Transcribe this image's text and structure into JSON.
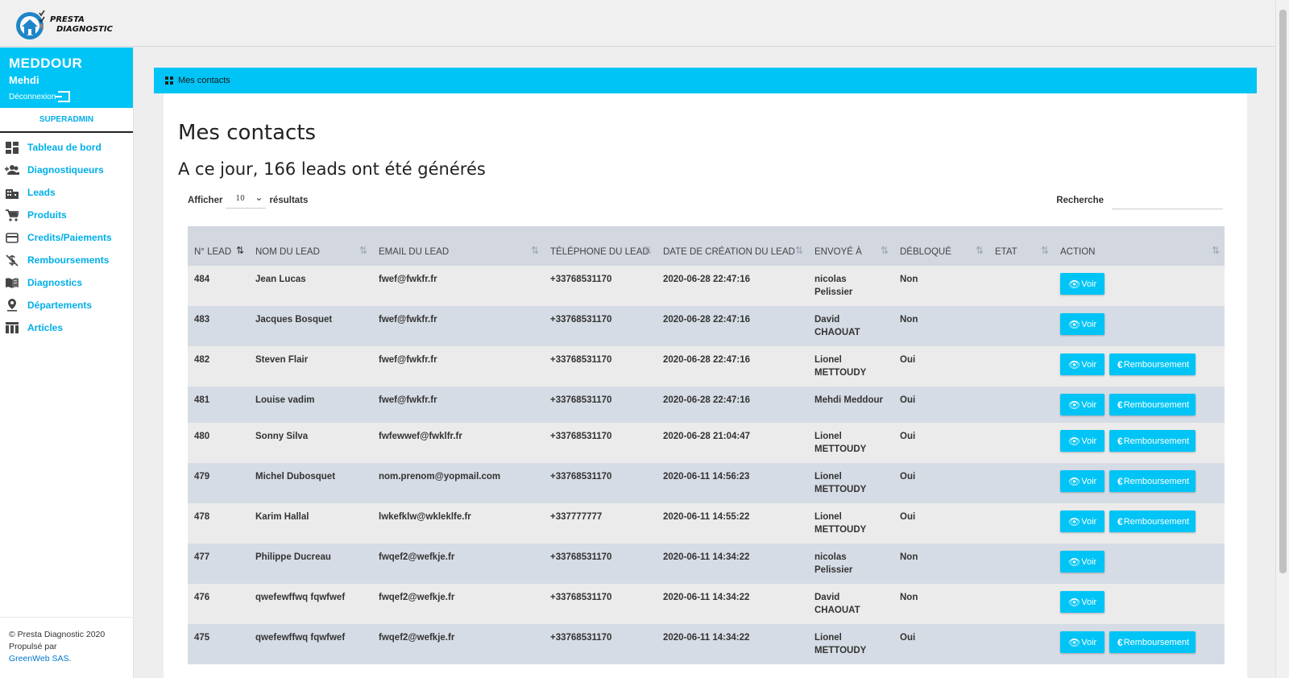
{
  "app": {
    "logo_line1": "PRESTA",
    "logo_line2": "DIAGNOSTIC"
  },
  "user": {
    "last_name": "MEDDOUR",
    "first_name": "Mehdi",
    "logout_label": "Déconnexion",
    "role": "SUPERADMIN"
  },
  "nav": [
    {
      "label": "Tableau de bord",
      "icon": "dashboard-icon"
    },
    {
      "label": "Diagnostiqueurs",
      "icon": "group-add-icon"
    },
    {
      "label": "Leads",
      "icon": "building-icon"
    },
    {
      "label": "Produits",
      "icon": "cart-icon"
    },
    {
      "label": "Credits/Paiements",
      "icon": "credit-card-icon"
    },
    {
      "label": "Remboursements",
      "icon": "money-off-icon"
    },
    {
      "label": "Diagnostics",
      "icon": "book-icon"
    },
    {
      "label": "Départements",
      "icon": "location-pin-icon"
    },
    {
      "label": "Articles",
      "icon": "table-icon"
    }
  ],
  "footer": {
    "copyright": "© Presta Diagnostic 2020",
    "powered": "Propulsé par",
    "company": "GreenWeb SAS",
    "dot": "."
  },
  "breadcrumb": "Mes contacts",
  "page": {
    "title": "Mes contacts",
    "subtitle": "A ce jour, 166 leads ont été générés",
    "show_label": "Afficher",
    "show_value": "10",
    "results_label": "résultats",
    "search_label": "Recherche"
  },
  "table": {
    "columns": [
      "N° LEAD",
      "NOM DU LEAD",
      "EMAIL DU LEAD",
      "TÉLÉPHONE DU LEAD",
      "DATE DE CRÉATION DU LEAD",
      "ENVOYÉ À",
      "DÉBLOQUÉ",
      "ETAT",
      "ACTION"
    ],
    "view_label": "Voir",
    "refund_label": "Remboursement",
    "rows": [
      {
        "id": "484",
        "name": "Jean Lucas",
        "email": "fwef@fwkfr.fr",
        "phone": "+33768531170",
        "date": "2020-06-28 22:47:16",
        "sent_to": "nicolas Pelissier",
        "unlocked": "Non",
        "state": "",
        "refund": false
      },
      {
        "id": "483",
        "name": "Jacques Bosquet",
        "email": "fwef@fwkfr.fr",
        "phone": "+33768531170",
        "date": "2020-06-28 22:47:16",
        "sent_to": "David CHAOUAT",
        "unlocked": "Non",
        "state": "",
        "refund": false
      },
      {
        "id": "482",
        "name": "Steven Flair",
        "email": "fwef@fwkfr.fr",
        "phone": "+33768531170",
        "date": "2020-06-28 22:47:16",
        "sent_to": "Lionel METTOUDY",
        "unlocked": "Oui",
        "state": "",
        "refund": true
      },
      {
        "id": "481",
        "name": "Louise vadim",
        "email": "fwef@fwkfr.fr",
        "phone": "+33768531170",
        "date": "2020-06-28 22:47:16",
        "sent_to": "Mehdi Meddour",
        "unlocked": "Oui",
        "state": "",
        "refund": true
      },
      {
        "id": "480",
        "name": "Sonny Silva",
        "email": "fwfewwef@fwklfr.fr",
        "phone": "+33768531170",
        "date": "2020-06-28 21:04:47",
        "sent_to": "Lionel METTOUDY",
        "unlocked": "Oui",
        "state": "",
        "refund": true
      },
      {
        "id": "479",
        "name": "Michel Dubosquet",
        "email": "nom.prenom@yopmail.com",
        "phone": "+33768531170",
        "date": "2020-06-11 14:56:23",
        "sent_to": "Lionel METTOUDY",
        "unlocked": "Oui",
        "state": "",
        "refund": true
      },
      {
        "id": "478",
        "name": "Karim Hallal",
        "email": "lwkefklw@wkleklfe.fr",
        "phone": "+337777777",
        "date": "2020-06-11 14:55:22",
        "sent_to": "Lionel METTOUDY",
        "unlocked": "Oui",
        "state": "",
        "refund": true
      },
      {
        "id": "477",
        "name": "Philippe Ducreau",
        "email": "fwqef2@wefkje.fr",
        "phone": "+33768531170",
        "date": "2020-06-11 14:34:22",
        "sent_to": "nicolas Pelissier",
        "unlocked": "Non",
        "state": "",
        "refund": false
      },
      {
        "id": "476",
        "name": "qwefewffwq fqwfwef",
        "email": "fwqef2@wefkje.fr",
        "phone": "+33768531170",
        "date": "2020-06-11 14:34:22",
        "sent_to": "David CHAOUAT",
        "unlocked": "Non",
        "state": "",
        "refund": false
      },
      {
        "id": "475",
        "name": "qwefewffwq fqwfwef",
        "email": "fwqef2@wefkje.fr",
        "phone": "+33768531170",
        "date": "2020-06-11 14:34:22",
        "sent_to": "Lionel METTOUDY",
        "unlocked": "Oui",
        "state": "",
        "refund": true
      }
    ]
  },
  "colors": {
    "accent": "#00c4f5",
    "link": "#00aee8",
    "header_row": "#d2d7e0",
    "row_odd": "#ebebeb",
    "row_even": "#d6dce5"
  }
}
